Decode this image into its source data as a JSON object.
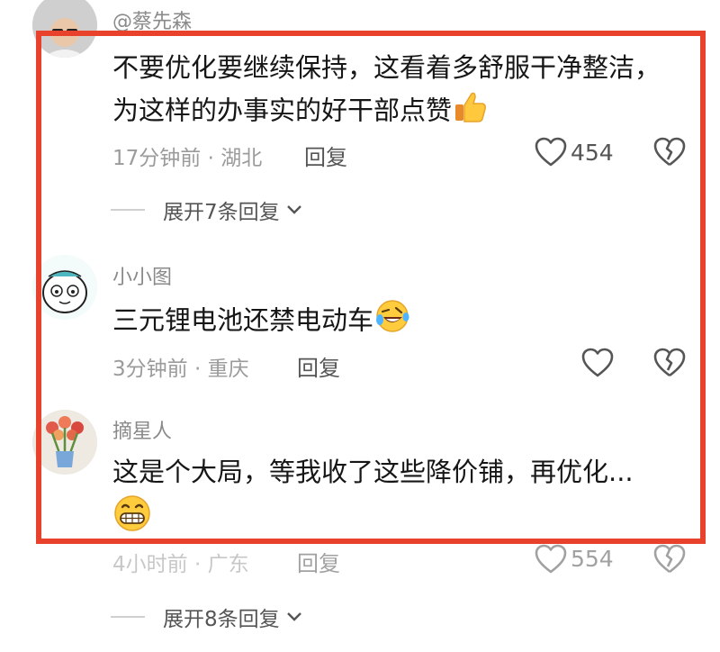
{
  "comments": [
    {
      "username": "@蔡先森",
      "text_line1": "不要优化要继续保持，这看着多舒服干净整洁，",
      "text_line2": "为这样的办事实的好干部点赞",
      "emoji": "thumbs-up-icon",
      "time": "17分钟前",
      "location": "湖北",
      "reply": "回复",
      "likes": "454",
      "expand": "展开7条回复"
    },
    {
      "username": "小小图",
      "text_line1": "三元锂电池还禁电动车",
      "emoji": "rofl-face-icon",
      "time": "3分钟前",
      "location": "重庆",
      "reply": "回复"
    },
    {
      "username": "摘星人",
      "text_line1": "这是个大局，等我收了这些降价铺，再优化...",
      "emoji": "grinning-face-icon",
      "time": "4小时前",
      "location": "广东",
      "reply": "回复",
      "likes": "554",
      "expand": "展开8条回复"
    }
  ],
  "meta_separator": "·",
  "colors": {
    "highlight_frame": "#e8412c"
  }
}
